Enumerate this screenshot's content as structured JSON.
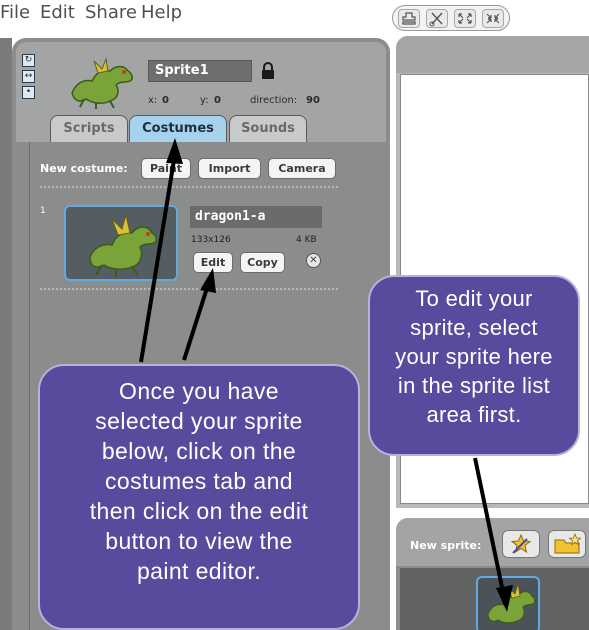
{
  "menu": {
    "items": [
      "File",
      "Edit",
      "Share",
      "Help"
    ]
  },
  "toolbar": {
    "tools": [
      "stamp-icon",
      "cut-icon",
      "grow-icon",
      "shrink-icon"
    ]
  },
  "sprite": {
    "name": "Sprite1",
    "x_label": "x:",
    "x_value": "0",
    "y_label": "y:",
    "y_value": "0",
    "direction_label": "direction:",
    "direction_value": "90"
  },
  "tabs": [
    {
      "label": "Scripts",
      "active": false
    },
    {
      "label": "Costumes",
      "active": true
    },
    {
      "label": "Sounds",
      "active": false
    }
  ],
  "costumes": {
    "new_costume_label": "New costume:",
    "buttons": [
      "Paint",
      "Import",
      "Camera"
    ],
    "items": [
      {
        "index": "1",
        "name": "dragon1-a",
        "size": "133x126",
        "file_size": "4 KB",
        "edit_label": "Edit",
        "copy_label": "Copy"
      }
    ]
  },
  "sprite_list": {
    "new_sprite_label": "New sprite:"
  },
  "callouts": {
    "left": [
      "Once you have",
      "selected your sprite",
      "below, click on the",
      "costumes tab and",
      "then click on the edit",
      "button to view the",
      "paint editor."
    ],
    "right": [
      "To edit your",
      "sprite, select",
      "your sprite here",
      "in the sprite list",
      "area first."
    ]
  },
  "colors": {
    "callout_bg": "#574b9d",
    "active_tab": "#a6d2ee",
    "panel_gray": "#8b8c8c"
  }
}
